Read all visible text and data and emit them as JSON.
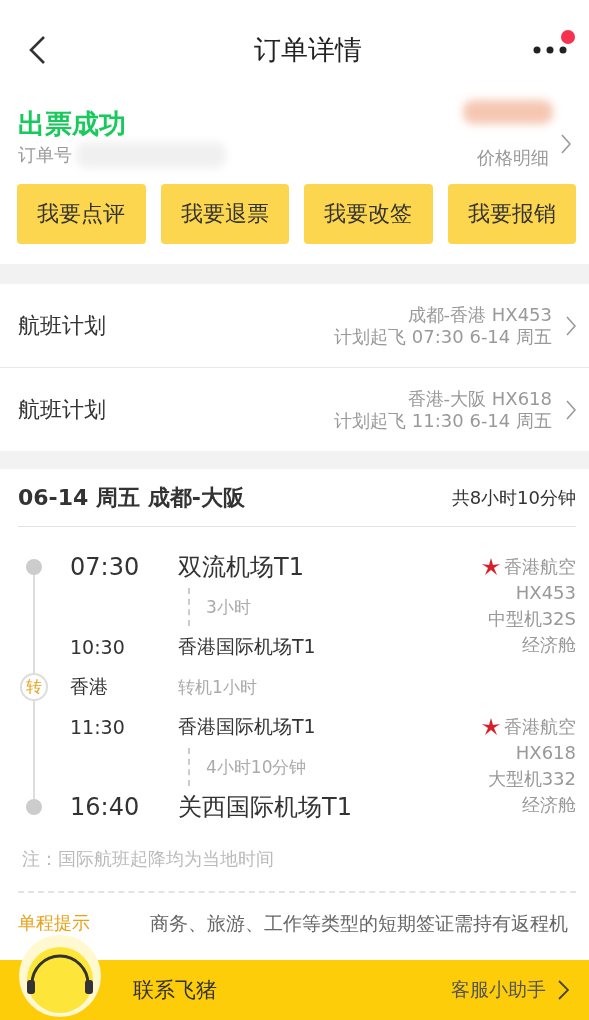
{
  "header": {
    "title": "订单详情",
    "has_notification": true
  },
  "status": {
    "text": "出票成功",
    "order_label": "订单号",
    "price_link": "价格明细"
  },
  "actions": [
    "我要点评",
    "我要退票",
    "我要改签",
    "我要报销"
  ],
  "flight_plans": [
    {
      "label": "航班计划",
      "route": "成都-香港 HX453",
      "schedule": "计划起飞 07:30 6-14 周五"
    },
    {
      "label": "航班计划",
      "route": "香港-大阪 HX618",
      "schedule": "计划起飞 11:30 6-14 周五"
    }
  ],
  "itinerary": {
    "title": "06-14 周五 成都-大阪",
    "total": "共8小时10分钟",
    "segments": [
      {
        "dep_time": "07:30",
        "dep_airport": "双流机场T1",
        "duration": "3小时",
        "arr_time": "10:30",
        "arr_airport": "香港国际机场T1",
        "airline": "香港航空",
        "flight": "HX453",
        "aircraft": "中型机32S",
        "cabin": "经济舱"
      },
      {
        "dep_time": "11:30",
        "dep_airport": "香港国际机场T1",
        "duration": "4小时10分钟",
        "arr_time": "16:40",
        "arr_airport": "关西国际机场T1",
        "airline": "香港航空",
        "flight": "HX618",
        "aircraft": "大型机332",
        "cabin": "经济舱"
      }
    ],
    "transfer": {
      "badge": "转",
      "city": "香港",
      "text": "转机1小时"
    },
    "note": "注：国际航班起降均为当地时间"
  },
  "tip": {
    "label": "单程提示",
    "text": "商务、旅游、工作等类型的短期签证需持有返程机"
  },
  "footer": {
    "contact": "联系飞猪",
    "assistant": "客服小助手"
  }
}
